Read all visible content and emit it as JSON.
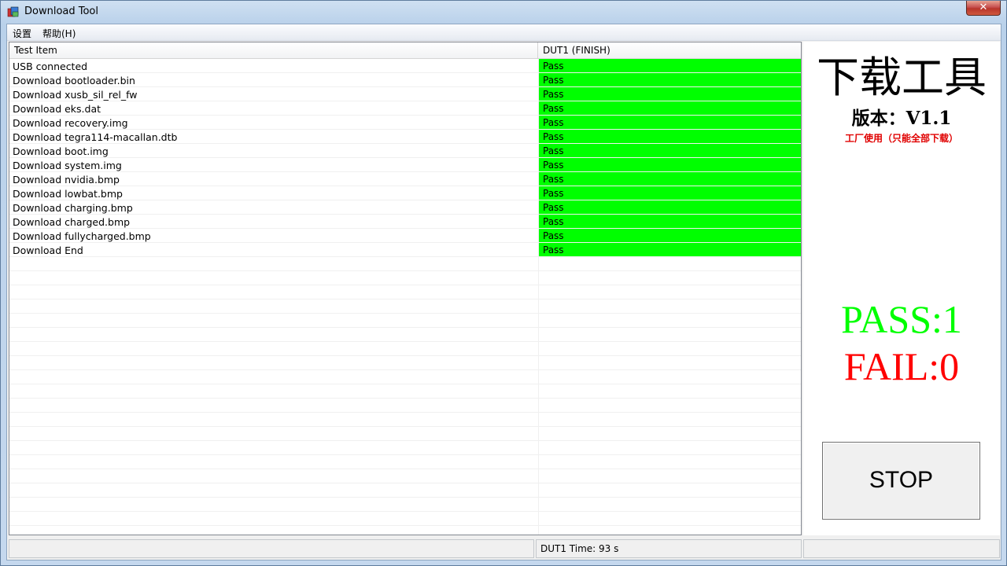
{
  "window": {
    "title": "Download Tool",
    "close_label": "✕"
  },
  "menu": [
    {
      "label": "设置"
    },
    {
      "label": "帮助(H)"
    }
  ],
  "list": {
    "columns": [
      "Test Item",
      "DUT1  (FINISH)"
    ],
    "rows": [
      {
        "item": "USB connected",
        "status": "Pass"
      },
      {
        "item": "Download bootloader.bin",
        "status": "Pass"
      },
      {
        "item": "Download xusb_sil_rel_fw",
        "status": "Pass"
      },
      {
        "item": "Download eks.dat",
        "status": "Pass"
      },
      {
        "item": "Download recovery.img",
        "status": "Pass"
      },
      {
        "item": "Download tegra114-macallan.dtb",
        "status": "Pass"
      },
      {
        "item": "Download boot.img",
        "status": "Pass"
      },
      {
        "item": "Download system.img",
        "status": "Pass"
      },
      {
        "item": "Download nvidia.bmp",
        "status": "Pass"
      },
      {
        "item": "Download lowbat.bmp",
        "status": "Pass"
      },
      {
        "item": "Download charging.bmp",
        "status": "Pass"
      },
      {
        "item": "Download charged.bmp",
        "status": "Pass"
      },
      {
        "item": "Download fullycharged.bmp",
        "status": "Pass"
      },
      {
        "item": "Download End",
        "status": "Pass"
      }
    ],
    "pass_color": "#00ff00"
  },
  "panel": {
    "title": "下载工具",
    "version": "版本：V1.1",
    "note": "工厂使用（只能全部下载）",
    "pass": "PASS:1",
    "fail": "FAIL:0",
    "stop_label": "STOP"
  },
  "statusbar": {
    "panel1": "",
    "panel2": "DUT1 Time: 93 s",
    "panel3": ""
  }
}
